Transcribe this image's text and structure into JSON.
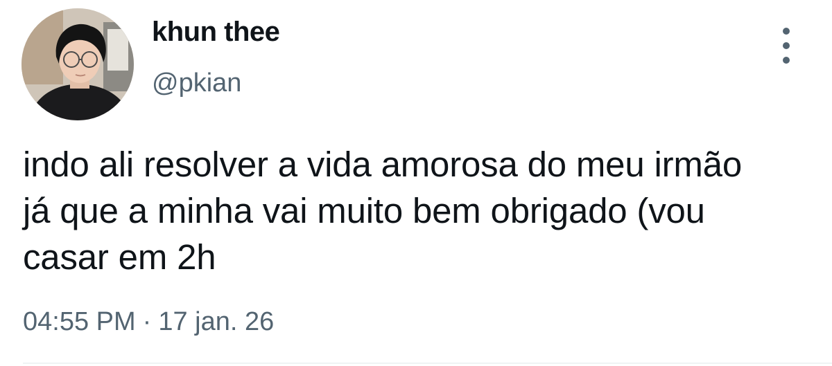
{
  "user": {
    "display_name": "khun thee",
    "handle": "@pkian",
    "avatar_icon": "profile-photo"
  },
  "tweet": {
    "text": "indo ali resolver a vida amorosa do meu irmão\njá que a minha vai muito bem obrigado (vou\ncasar em 2h",
    "time": "04:55 PM",
    "separator": "·",
    "date": "17 jan. 26"
  },
  "actions": {
    "more_icon": "more-vertical-icon"
  },
  "colors": {
    "text_primary": "#0f1419",
    "text_secondary": "#536471",
    "divider": "#eff3f4"
  }
}
